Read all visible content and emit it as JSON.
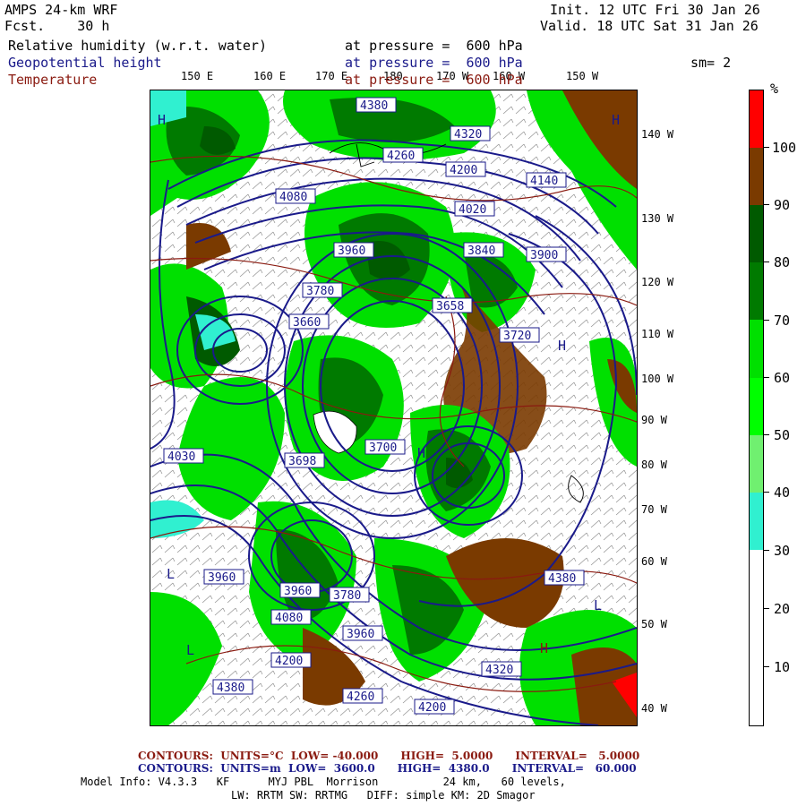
{
  "header": {
    "model": "AMPS 24-km WRF",
    "fcst": "Fcst.    30 h",
    "init": "Init. 12 UTC Fri 30 Jan 26",
    "valid": "Valid. 18 UTC Sat 31 Jan 26",
    "fields": [
      {
        "name": "Relative humidity (w.r.t. water)",
        "pressure": "at pressure =  600 hPa",
        "color": "#000000"
      },
      {
        "name": "Geopotential height",
        "pressure": "at pressure =  600 hPa",
        "color": "#1a1a8a"
      },
      {
        "name": "Temperature",
        "pressure": "at pressure =  600 hPa",
        "color": "#8a1a10"
      }
    ],
    "smooth": "sm= 2"
  },
  "lon_labels": [
    "150 E",
    "160 E",
    "170 E",
    "180",
    "170 W",
    "160 W",
    "150 W"
  ],
  "lat_labels": [
    "140 W",
    "130 W",
    "120 W",
    "110 W",
    "100 W",
    "90 W",
    "80 W",
    "70 W",
    "60 W",
    "50 W",
    "40 W"
  ],
  "colorbar": {
    "unit": "%",
    "labels": [
      "100",
      "90",
      "80",
      "70",
      "60",
      "50",
      "40",
      "30",
      "20",
      "10"
    ],
    "colors": [
      "#ff0000",
      "#7a3a00",
      "#005a00",
      "#007a00",
      "#00e000",
      "#70f070",
      "#00e0b0",
      "#30f0d0",
      "#ffffff",
      "#ffffff",
      "#ffffff"
    ]
  },
  "height_labels": [
    "4380",
    "4320",
    "4260",
    "4200",
    "4140",
    "4080",
    "4020",
    "3960",
    "3900",
    "3840",
    "3780",
    "3720",
    "3700",
    "3660",
    "3658",
    "3698",
    "4030"
  ],
  "map_markers": [
    "H",
    "L"
  ],
  "footer": {
    "temp_contours": "CONTOURS:  UNITS=°C  LOW= -40.000      HIGH=  5.0000      INTERVAL=   5.0000",
    "height_contours": "CONTOURS:  UNITS=m  LOW=  3600.0      HIGH=  4380.0      INTERVAL=   60.000",
    "model_info": "Model Info: V4.3.3   KF      MYJ PBL  Morrison          24 km,   60 levels,",
    "physics": "LW: RRTM SW: RRTMG   DIFF: simple KM: 2D Smagor"
  },
  "colors": {
    "height_contour": "#1a1a8a",
    "temp_contour": "#8a1a10",
    "rh_90_100": "#7a3a00",
    "rh_80_90": "#005a00",
    "rh_70_80": "#007a00",
    "rh_60_70": "#00e000",
    "rh_30_50": "#30f0d0",
    "rh_100": "#ff0000"
  }
}
